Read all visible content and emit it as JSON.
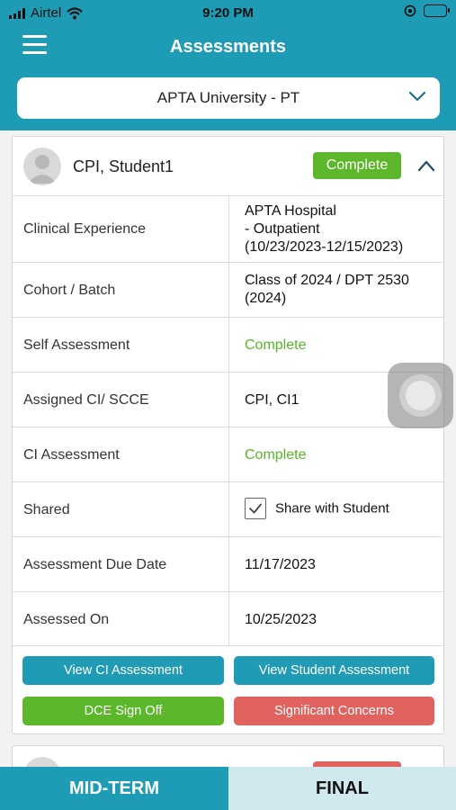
{
  "status_bar": {
    "carrier": "Airtel",
    "time": "9:20 PM"
  },
  "header": {
    "title": "Assessments"
  },
  "program_select": {
    "selected": "APTA University - PT"
  },
  "card": {
    "student_name": "CPI, Student1",
    "status_badge": "Complete",
    "rows": [
      {
        "label": "Clinical Experience",
        "value_lines": [
          "APTA Hospital",
          "- Outpatient",
          "(10/23/2023-12/15/2023)"
        ]
      },
      {
        "label": "Cohort / Batch",
        "value_lines": [
          "Class of 2024 / DPT 2530",
          "(2024)"
        ]
      },
      {
        "label": "Self Assessment",
        "value": "Complete"
      },
      {
        "label": "Assigned CI/ SCCE",
        "value": "CPI, CI1"
      },
      {
        "label": "CI Assessment",
        "value": "Complete"
      },
      {
        "label": "Shared",
        "checkbox_label": "Share with Student",
        "checked": true
      },
      {
        "label": "Assessment Due Date",
        "value": "11/17/2023"
      },
      {
        "label": "Assessed On",
        "value": "10/25/2023"
      }
    ],
    "buttons": {
      "view_ci": "View CI Assessment",
      "view_student": "View Student Assessment",
      "dce_sign_off": "DCE Sign Off",
      "significant_concerns": "Significant Concerns"
    }
  },
  "tabs": {
    "mid_term": "MID-TERM",
    "final": "FINAL"
  },
  "colors": {
    "teal": "#1e9bb5",
    "green": "#5cb82a",
    "red": "#e06360",
    "final_tab_bg": "#cfe9ee"
  }
}
